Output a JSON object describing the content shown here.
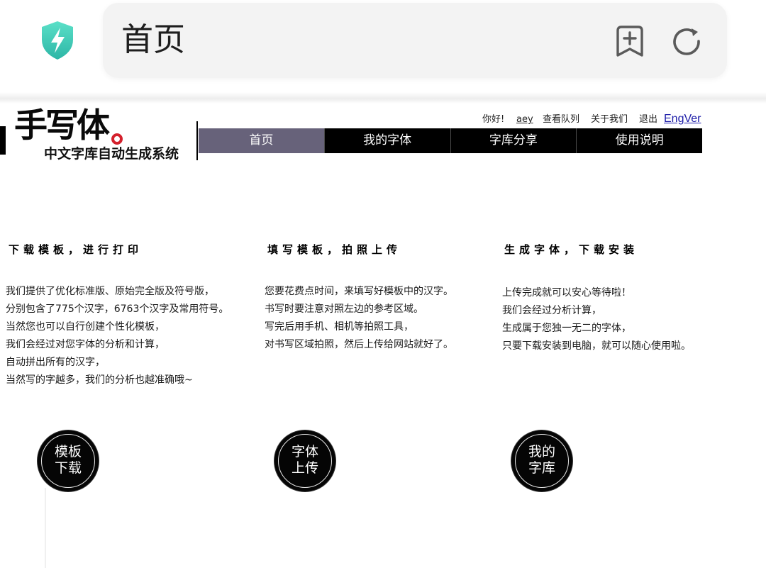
{
  "browser": {
    "title": "首页",
    "security_icon": "shield-bolt-icon",
    "bookmark_icon": "bookmark-add-icon",
    "refresh_icon": "refresh-icon",
    "shield_color": "#3fcfb8"
  },
  "header": {
    "logo_text": "手写体",
    "logo_subtitle": "中文字库自动生成系统",
    "greeting": "你好!",
    "username": "aey",
    "queue_link": "查看队列",
    "about_link": "关于我们",
    "logout_link": "退出",
    "lang_link": "EngVer",
    "lang_link_color": "#1c1ca8",
    "logo_dot_color": "#d4202c"
  },
  "nav": {
    "items": [
      {
        "label": "首页",
        "active": true
      },
      {
        "label": "我的字体",
        "active": false
      },
      {
        "label": "字库分享",
        "active": false
      },
      {
        "label": "使用说明",
        "active": false
      }
    ],
    "active_color": "#67627a",
    "bg_color": "#000000"
  },
  "steps": [
    {
      "title": "下载模板，进行打印",
      "lines": [
        "我们提供了优化标准版、原始完全版及符号版，",
        "分别包含了775个汉字，6763个汉字及常用符号。",
        "当然您也可以自行创建个性化模板，",
        "我们会经过对您字体的分析和计算，",
        "自动拼出所有的汉字，",
        "当然写的字越多，我们的分析也越准确哦~"
      ],
      "button_lines": [
        "模板",
        "下载"
      ]
    },
    {
      "title": "填写模板，拍照上传",
      "lines": [
        "您要花费点时间，来填写好模板中的汉字。",
        "书写时要注意对照左边的参考区域。",
        "写完后用手机、相机等拍照工具，",
        "对书写区域拍照，然后上传给网站就好了。"
      ],
      "button_lines": [
        "字体",
        "上传"
      ]
    },
    {
      "title": "生成字体，下载安装",
      "lines": [
        "上传完成就可以安心等待啦！",
        "我们会经过分析计算，",
        "生成属于您独一无二的字体，",
        "只要下载安装到电脑，就可以随心使用啦。"
      ],
      "button_lines": [
        "我的",
        "字库"
      ]
    }
  ]
}
